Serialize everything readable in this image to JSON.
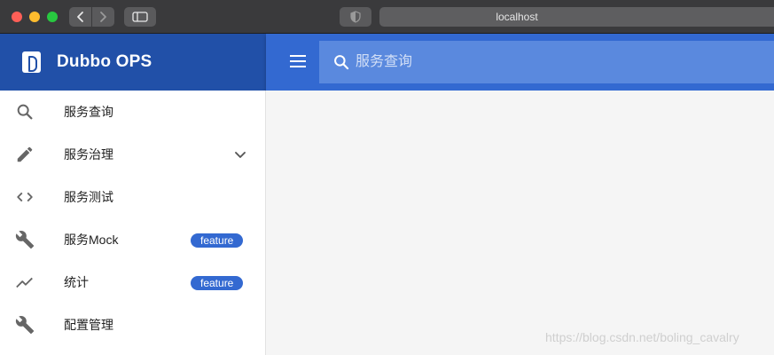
{
  "browser": {
    "url": "localhost",
    "traffic_lights": [
      "close",
      "minimize",
      "maximize"
    ],
    "nav_icons": [
      "back-icon",
      "forward-icon"
    ],
    "sidebar_toggle_icon": "sidebar-toggle-icon",
    "shield_icon": "shield-icon"
  },
  "header": {
    "brand_title": "Dubbo OPS",
    "brand_color": "#2150a8",
    "topbar_color": "#3369d1",
    "menu_icon": "menu-icon",
    "search": {
      "icon": "search-icon",
      "placeholder": "服务查询"
    }
  },
  "sidebar": {
    "items": [
      {
        "label": "服务查询",
        "icon": "search-icon"
      },
      {
        "label": "服务治理",
        "icon": "pencil-icon",
        "expand_icon": "chevron-down-icon"
      },
      {
        "label": "服务测试",
        "icon": "code-icon"
      },
      {
        "label": "服务Mock",
        "icon": "wrench-icon",
        "badge": "feature"
      },
      {
        "label": "统计",
        "icon": "trending-up-icon",
        "badge": "feature"
      },
      {
        "label": "配置管理",
        "icon": "wrench-icon"
      }
    ],
    "badge_color": "#3369d1"
  },
  "watermark": "https://blog.csdn.net/boling_cavalry"
}
